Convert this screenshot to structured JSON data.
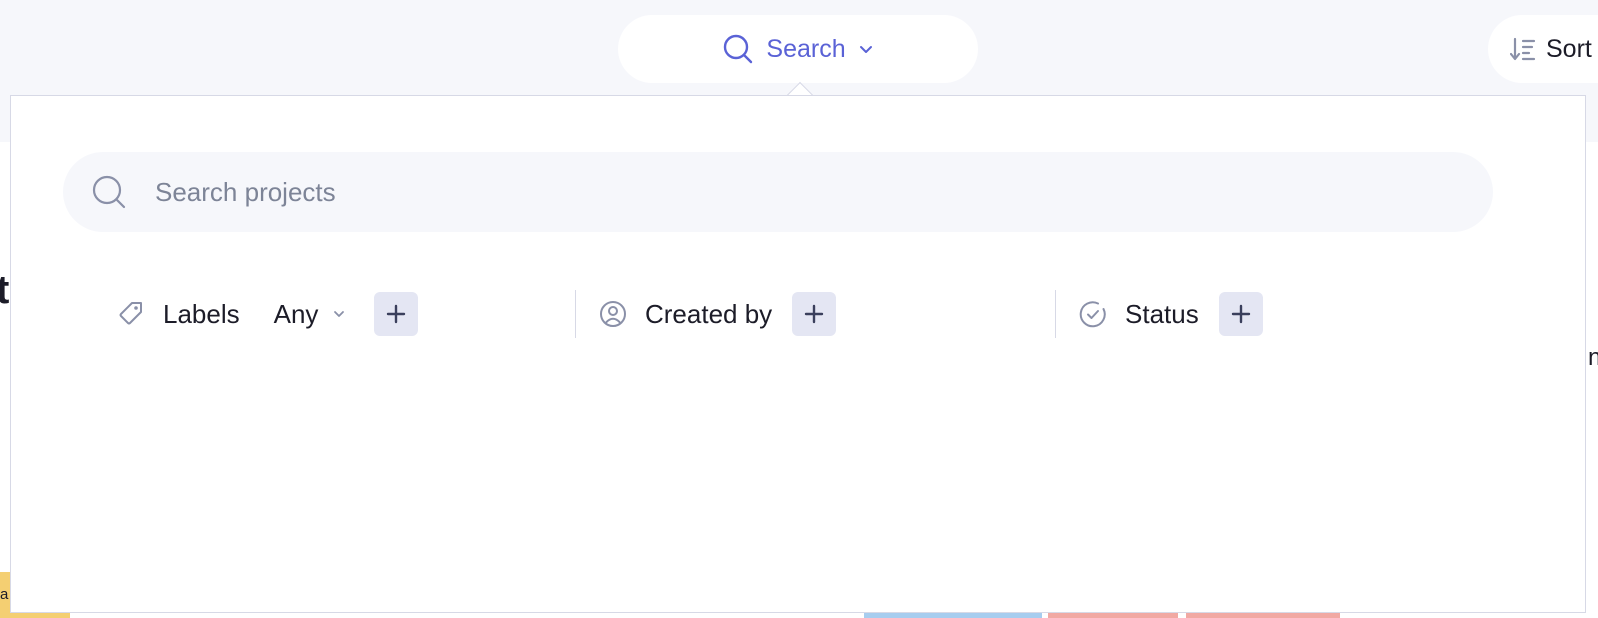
{
  "toolbar": {
    "search_label": "Search",
    "sort_label": "Sort"
  },
  "search": {
    "placeholder": "Search projects",
    "value": ""
  },
  "filters": {
    "labels": {
      "label": "Labels",
      "value": "Any"
    },
    "created_by": {
      "label": "Created by"
    },
    "status": {
      "label": "Status"
    }
  },
  "background": {
    "title_fragment": "t",
    "right_fragment": "n",
    "tag_fragment": "a"
  },
  "icons": {
    "search": "search-icon",
    "chevron": "chevron-down-icon",
    "sort": "sort-icon",
    "tag": "tag-icon",
    "user": "user-icon",
    "status": "check-circle-icon",
    "add": "plus-icon"
  },
  "colors": {
    "accent": "#5a62d6",
    "toolbar_background": "#f6f7fb",
    "add_button": "#e4e6f3",
    "muted_icon": "#8a90a8"
  }
}
